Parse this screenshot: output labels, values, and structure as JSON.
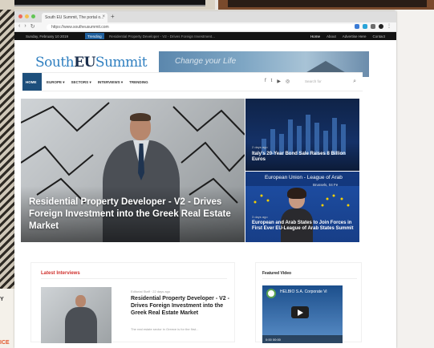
{
  "browser": {
    "tab_title": "South EU Summit, The portal o...",
    "url": "https://www.southeusummit.com"
  },
  "topbar": {
    "date": "Sunday, February 10 2019",
    "trending_label": "Trending",
    "ticker": "Residential Property Developer - V2 - Drives Foreign Investment...",
    "links": [
      "Home",
      "About",
      "Advertise Here",
      "Contact"
    ]
  },
  "logo": {
    "part1": "South",
    "part2": "EU",
    "part3": "Summit"
  },
  "banner": {
    "text": "Change your Life"
  },
  "nav": {
    "home": "HOME",
    "items": [
      "EUROPE ▾",
      "SECTORS ▾",
      "INTERVIEWS ▾",
      "TRENDING"
    ],
    "search_placeholder": "Search for"
  },
  "hero": {
    "title": "Residential Property Developer - V2 - Drives Foreign Investment into the Greek Real Estate Market"
  },
  "side_stories": [
    {
      "meta": "2 days ago",
      "title": "Italy's 20-Year Bond Sale Raises 8 Billion Euros"
    },
    {
      "band": "European Union - League of Arab",
      "band_sub": "Brussels, 04 Fe",
      "meta": "3 days ago",
      "title": "European and Arab States to Join Forces in First Ever EU-League of Arab States Summit"
    }
  ],
  "latest": {
    "section": "Latest Interviews",
    "meta": "Editorial Staff · 22 days ago",
    "title": "Residential Property Developer - V2 - Drives Foreign Investment into the Greek Real Estate Market",
    "excerpt": "The real estate sector in Greece is for the first..."
  },
  "featured": {
    "section": "Featured Video",
    "video_title": "HELBIO S.A. Corporate Vi",
    "controls": "0:00  00:00"
  },
  "photo_edge": {
    "left_text": "Y",
    "left_text_2": "ICE"
  }
}
